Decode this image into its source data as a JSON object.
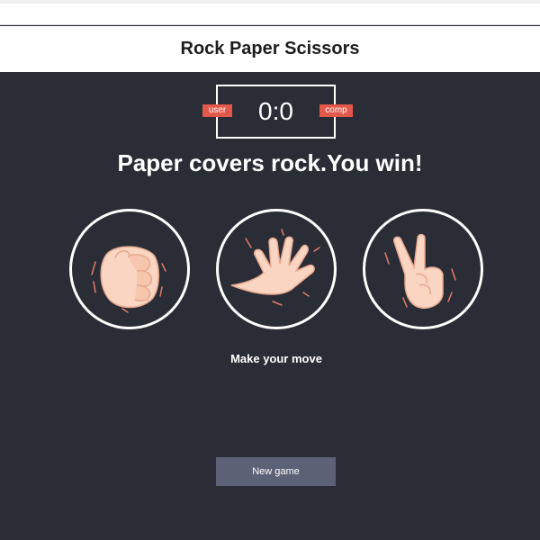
{
  "header": {
    "title": "Rock Paper Scissors"
  },
  "scoreboard": {
    "score": "0:0",
    "user_label": "user",
    "comp_label": "comp"
  },
  "result_message": "Paper covers rock.You win!",
  "choices": [
    {
      "id": "rock",
      "icon": "rock-hand-icon"
    },
    {
      "id": "paper",
      "icon": "paper-hand-icon"
    },
    {
      "id": "scissors",
      "icon": "scissors-hand-icon"
    }
  ],
  "prompt": "Make your move",
  "new_game_label": "New game",
  "colors": {
    "background": "#2a2c36",
    "badge": "#e2584a",
    "button": "#5c6175",
    "skin": "#f9d5c2"
  }
}
